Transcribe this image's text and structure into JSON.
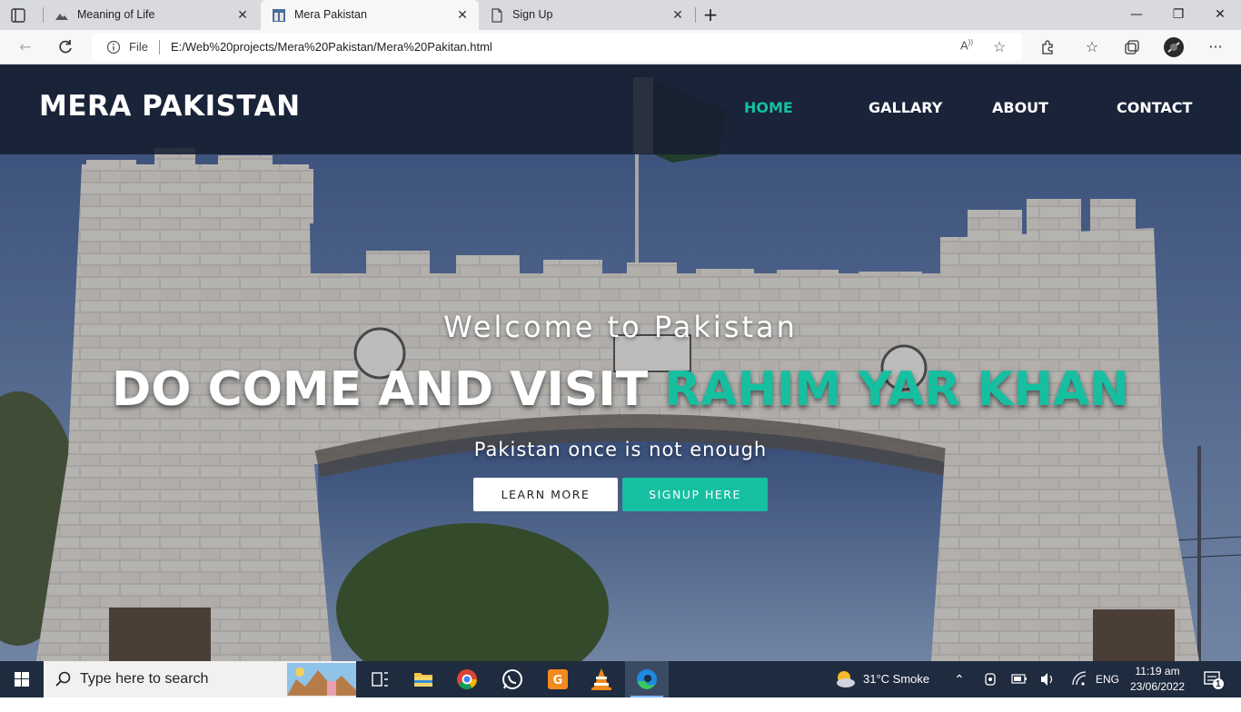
{
  "browser": {
    "tabs": [
      {
        "title": "Meaning of Life",
        "active": false
      },
      {
        "title": "Mera Pakistan",
        "active": true
      },
      {
        "title": "Sign Up",
        "active": false
      }
    ],
    "address": {
      "scheme_label": "File",
      "url": "E:/Web%20projects/Mera%20Pakistan/Mera%20Pakitan.html"
    }
  },
  "page": {
    "logo": "MERA PAKISTAN",
    "nav": [
      "HOME",
      "GALLARY",
      "ABOUT",
      "CONTACT"
    ],
    "active_nav": "HOME",
    "welcome": "Welcome to Pakistan",
    "headline_part1": "DO COME AND VISIT",
    "headline_part2": "RAHIM YAR KHAN",
    "tagline": "Pakistan once is not enough",
    "learn_more_label": "LEARN MORE",
    "signup_label": "SIGNUP HERE",
    "accent_color": "#17bfa1",
    "navbar_color": "#161e30"
  },
  "taskbar": {
    "search_placeholder": "Type here to search",
    "weather": "31°C  Smoke",
    "language": "ENG",
    "time": "11‎:19 am",
    "date": "23/06/2022",
    "notification_count": "1"
  }
}
